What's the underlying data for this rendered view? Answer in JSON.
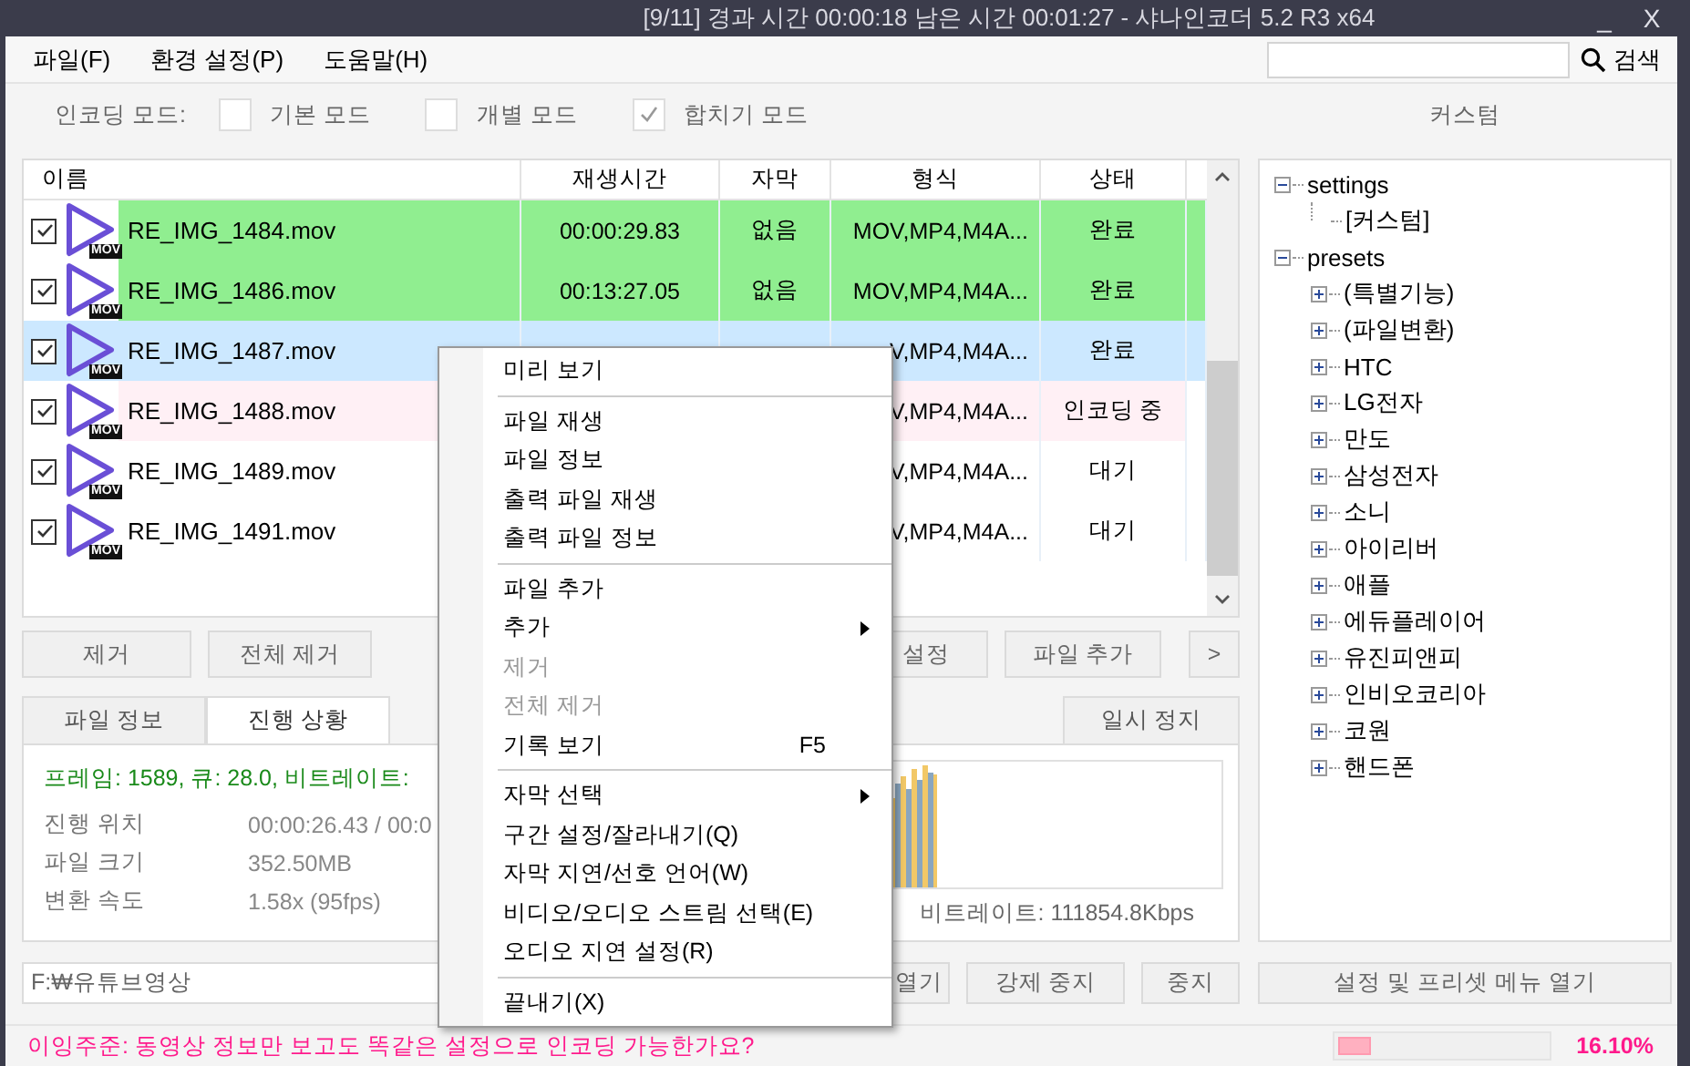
{
  "window": {
    "title": "[9/11] 경과 시간 00:00:18  남은 시간 00:01:27 - 샤나인코더 5.2 R3  x64",
    "minimize": "_",
    "close": "X"
  },
  "menu_bar": [
    "파일(F)",
    "환경 설정(P)",
    "도움말(H)"
  ],
  "search": {
    "button": "검색"
  },
  "encoding_mode": {
    "label": "인코딩 모드:",
    "options": [
      {
        "label": "기본 모드",
        "checked": false
      },
      {
        "label": "개별 모드",
        "checked": false
      },
      {
        "label": "합치기 모드",
        "checked": true
      }
    ]
  },
  "preset_heading": "커스텀",
  "file_table": {
    "columns": [
      "이름",
      "재생시간",
      "자막",
      "형식",
      "상태"
    ],
    "rows": [
      {
        "checked": true,
        "badge": "MOV",
        "name": "RE_IMG_1484.mov",
        "duration": "00:00:29.83",
        "subtitle": "없음",
        "format": "MOV,MP4,M4A...",
        "status": "완료",
        "color": "#90ee90",
        "selected": false
      },
      {
        "checked": true,
        "badge": "MOV",
        "name": "RE_IMG_1486.mov",
        "duration": "00:13:27.05",
        "subtitle": "없음",
        "format": "MOV,MP4,M4A...",
        "status": "완료",
        "color": "#90ee90",
        "selected": false
      },
      {
        "checked": true,
        "badge": "MOV",
        "name": "RE_IMG_1487.mov",
        "format": "V,MP4,M4A...",
        "status": "완료",
        "selected": true
      },
      {
        "checked": true,
        "badge": "MOV",
        "name": "RE_IMG_1488.mov",
        "format": "V,MP4,M4A...",
        "status": "인코딩 중",
        "color": "#fff0f5",
        "selected": false
      },
      {
        "checked": true,
        "badge": "MOV",
        "name": "RE_IMG_1489.mov",
        "format": "V,MP4,M4A...",
        "status": "대기",
        "selected": false
      },
      {
        "checked": true,
        "badge": "MOV",
        "name": "RE_IMG_1491.mov",
        "format": "V,MP4,M4A...",
        "status": "대기",
        "selected": false
      }
    ]
  },
  "list_buttons": [
    "제거",
    "전체 제거",
    "설정",
    "파일 추가",
    ">"
  ],
  "info_tabs": [
    {
      "label": "파일 정보",
      "selected": false
    },
    {
      "label": "진행 상황",
      "selected": true
    }
  ],
  "pause_button": "일시 정지",
  "progress": {
    "summary": "프레임: 1589, 큐: 28.0, 비트레이트:",
    "stats": [
      {
        "label": "진행 위치",
        "value": "00:00:26.43 / 00:0"
      },
      {
        "label": "파일 크기",
        "value": "352.50MB"
      },
      {
        "label": "변환 속도",
        "value": "1.58x (95fps)"
      }
    ],
    "graph_caption": "비트레이트: 111854.8Kbps"
  },
  "output_path": "F:₩유튜브영상",
  "bottom_buttons": [
    "열기",
    "강제 중지",
    "중지"
  ],
  "preset_menu_button": "설정 및 프리셋 메뉴 열기",
  "preset_tree": [
    {
      "label": "settings",
      "expanded": true,
      "children": [
        {
          "label": "[커스텀]"
        }
      ]
    },
    {
      "label": "presets",
      "expanded": true,
      "children": [
        {
          "label": "(특별기능)",
          "expanded": false
        },
        {
          "label": "(파일변환)",
          "expanded": false
        },
        {
          "label": "HTC",
          "expanded": false
        },
        {
          "label": "LG전자",
          "expanded": false
        },
        {
          "label": "만도",
          "expanded": false
        },
        {
          "label": "삼성전자",
          "expanded": false
        },
        {
          "label": "소니",
          "expanded": false
        },
        {
          "label": "아이리버",
          "expanded": false
        },
        {
          "label": "애플",
          "expanded": false
        },
        {
          "label": "에듀플레이어",
          "expanded": false
        },
        {
          "label": "유진피앤피",
          "expanded": false
        },
        {
          "label": "인비오코리아",
          "expanded": false
        },
        {
          "label": "코원",
          "expanded": false
        },
        {
          "label": "핸드폰",
          "expanded": false
        }
      ]
    }
  ],
  "status_bar": {
    "message": "이잉주준: 동영상 정보만 보고도 똑같은 설정으로 인코딩 가능한가요?",
    "progress": {
      "level": 0.161
    },
    "percent": "16.10%"
  },
  "context_menu": [
    {
      "kind": "command",
      "label": "미리 보기",
      "disabled": false
    },
    {
      "kind": "separator"
    },
    {
      "kind": "command",
      "label": "파일 재생",
      "disabled": false
    },
    {
      "kind": "command",
      "label": "파일 정보",
      "disabled": false
    },
    {
      "kind": "command",
      "label": "출력 파일 재생",
      "disabled": false
    },
    {
      "kind": "command",
      "label": "출력 파일 정보",
      "disabled": false
    },
    {
      "kind": "separator"
    },
    {
      "kind": "command",
      "label": "파일 추가",
      "disabled": false
    },
    {
      "kind": "submenu",
      "label": "추가",
      "disabled": false
    },
    {
      "kind": "command",
      "label": "제거",
      "disabled": true
    },
    {
      "kind": "command",
      "label": "전체 제거",
      "disabled": true
    },
    {
      "kind": "command",
      "label": "기록 보기",
      "shortcut": "F5",
      "disabled": false
    },
    {
      "kind": "separator"
    },
    {
      "kind": "submenu",
      "label": "자막 선택",
      "disabled": false
    },
    {
      "kind": "command",
      "label": "구간 설정/잘라내기(Q)",
      "disabled": false
    },
    {
      "kind": "command",
      "label": "자막 지연/선호 언어(W)",
      "disabled": false
    },
    {
      "kind": "command",
      "label": "비디오/오디오 스트림 선택(E)",
      "disabled": false
    },
    {
      "kind": "command",
      "label": "오디오 지연 설정(R)",
      "disabled": false
    },
    {
      "kind": "separator"
    },
    {
      "kind": "command",
      "label": "끝내기(X)",
      "disabled": false
    }
  ]
}
